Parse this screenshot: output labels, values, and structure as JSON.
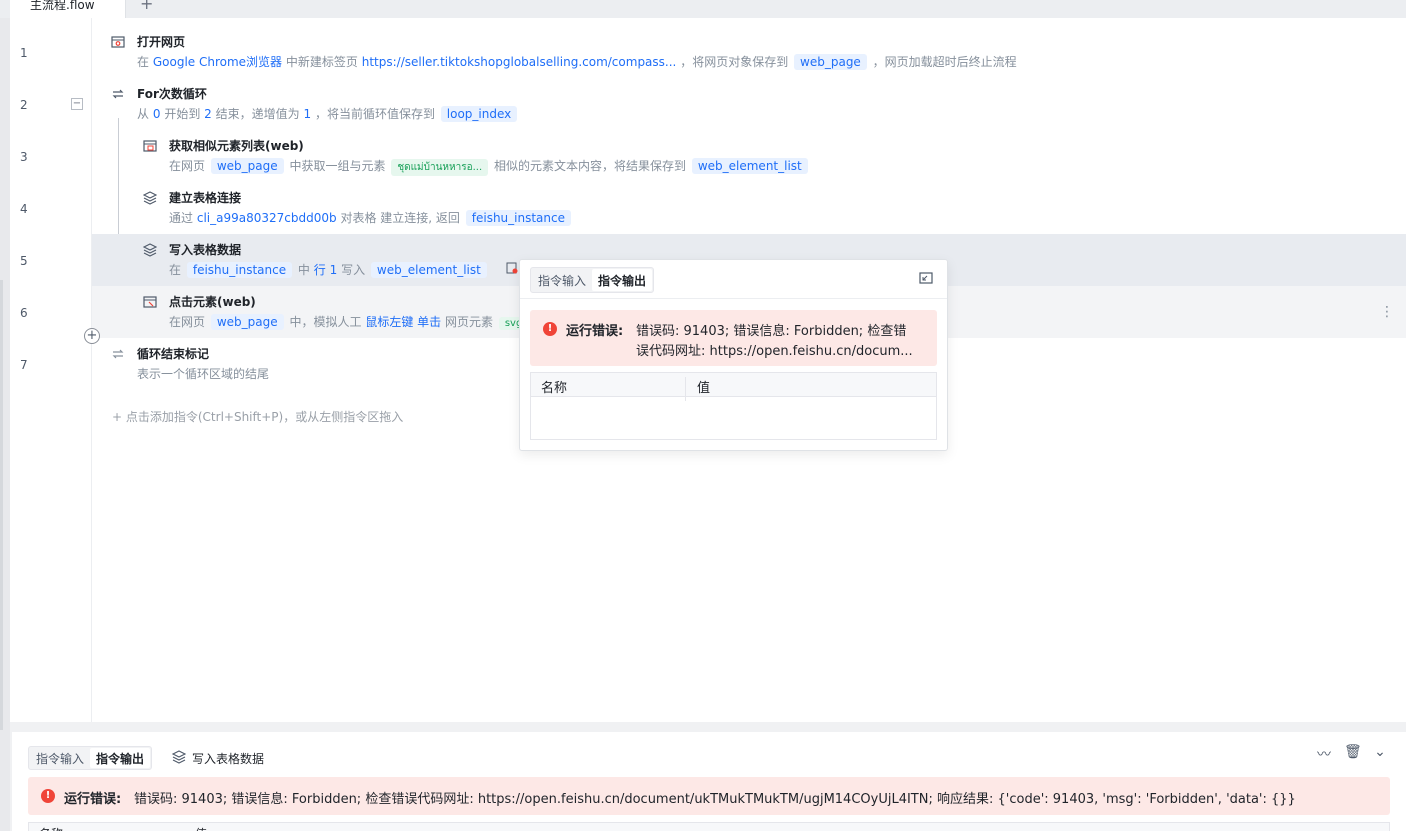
{
  "tab": {
    "name": "主流程.flow",
    "add": "+"
  },
  "line_numbers": [
    "1",
    "2",
    "3",
    "4",
    "5",
    "6",
    "7"
  ],
  "steps": [
    {
      "title": "打开网页",
      "desc": {
        "p1": "在",
        "browser": "Google Chrome浏览器",
        "p2": "中新建标签页",
        "url": "https://seller.tiktokshopglobalselling.com/compass...",
        "p3": "，将网页对象保存到",
        "var": "web_page",
        "p4": "，网页加载超时后终止流程"
      }
    },
    {
      "title": "For次数循环",
      "desc": {
        "p1": "从",
        "start": "0",
        "p2": "开始到",
        "end": "2",
        "p3": "结束，递增值为",
        "step": "1",
        "p4": "，将当前循环值保存到",
        "var": "loop_index"
      }
    },
    {
      "title": "获取相似元素列表(web)",
      "desc": {
        "p1": "在网页",
        "page": "web_page",
        "p2": "中获取一组与元素",
        "elem": "ชุดแม่บ้านหหารอ...",
        "p3": "相似的元素文本内容，将结果保存到",
        "var": "web_element_list"
      }
    },
    {
      "title": "建立表格连接",
      "desc": {
        "p1": "通过",
        "app": "cli_a99a80327cbdd00b",
        "p2": "对表格",
        "p3": "建立连接, 返回",
        "var": "feishu_instance"
      }
    },
    {
      "title": "写入表格数据",
      "desc": {
        "p1": "在",
        "inst": "feishu_instance",
        "p2": "中",
        "kw": "行",
        "num": "1",
        "p3": "写入",
        "var": "web_element_list"
      }
    },
    {
      "title": "点击元素(web)",
      "desc": {
        "p1": "在网页",
        "page": "web_page",
        "p2": "中，模拟人工",
        "btn": "鼠标左键",
        "click": "单击",
        "p3": "网页元素",
        "elem": "svg"
      }
    },
    {
      "title": "循环结束标记",
      "desc": {
        "p1": "表示一个循环区域的结尾"
      }
    }
  ],
  "collapse_symbol": "−",
  "add_symbol": "+",
  "add_hint": "+ 点击添加指令(Ctrl+Shift+P)，或从左侧指令区拖入",
  "kebab": "⋮",
  "popup": {
    "tab_input": "指令输入",
    "tab_output": "指令输出",
    "err_icon": "!",
    "err_label": "运行错误:",
    "err_line1": "错误码: 91403; 错误信息: Forbidden; 检查错",
    "err_line2": "误代码网址: https://open.feishu.cn/docum...",
    "col_name": "名称",
    "col_value": "值"
  },
  "bottom": {
    "tab_input": "指令输入",
    "tab_output": "指令输出",
    "title": "写入表格数据",
    "icons": [
      "〰",
      "🗑",
      "⌄"
    ],
    "err_icon": "!",
    "err_label": "运行错误:",
    "err_text": "错误码: 91403; 错误信息: Forbidden; 检查错误代码网址: https://open.feishu.cn/document/ukTMukTMukTM/ugjM14COyUjL4ITN; 响应结果: {'code': 91403, 'msg': 'Forbidden', 'data': {}}",
    "col_name": "名称",
    "col_value": "值"
  },
  "colors": {
    "accent": "#1f6ef7",
    "error_bg": "#fde8e6",
    "error_icon": "#f04438",
    "highlight_row": "#e8ebf0"
  }
}
